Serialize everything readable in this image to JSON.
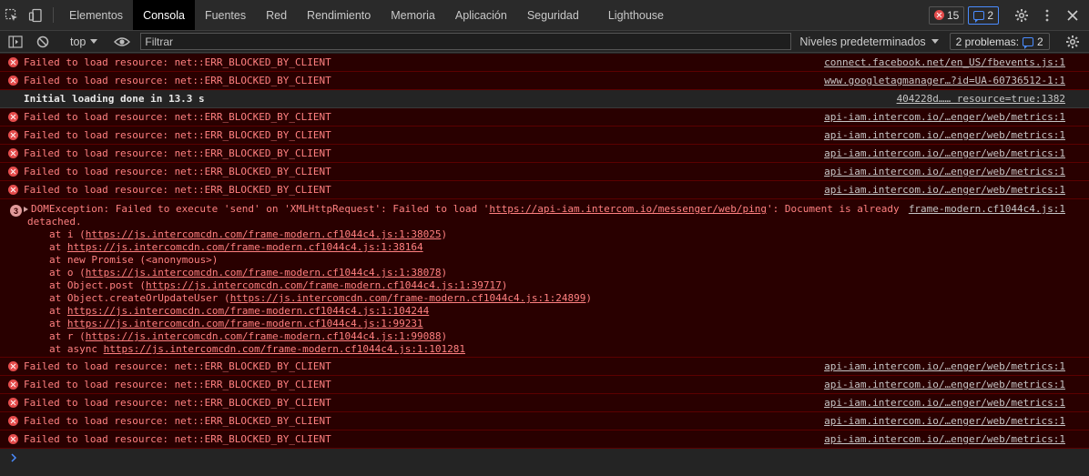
{
  "tabs": [
    "Elementos",
    "Consola",
    "Fuentes",
    "Red",
    "Rendimiento",
    "Memoria",
    "Aplicación",
    "Seguridad",
    "Lighthouse"
  ],
  "active_tab": "Consola",
  "badges": {
    "errors": "15",
    "issues": "2"
  },
  "toolbar": {
    "context": "top",
    "filter_placeholder": "Filtrar",
    "levels": "Niveles predeterminados",
    "problems_label": "2 problemas:",
    "problems_count": "2"
  },
  "messages": [
    {
      "type": "error",
      "text": "Failed to load resource: net::ERR_BLOCKED_BY_CLIENT",
      "source": "connect.facebook.net/en_US/fbevents.js:1"
    },
    {
      "type": "error",
      "text": "Failed to load resource: net::ERR_BLOCKED_BY_CLIENT",
      "source": "www.googletagmanager…?id=UA-60736512-1:1"
    },
    {
      "type": "info",
      "text": "Initial loading done in 13.3 s",
      "source": "404228d…… resource=true:1382"
    },
    {
      "type": "error",
      "text": "Failed to load resource: net::ERR_BLOCKED_BY_CLIENT",
      "source": "api-iam.intercom.io/…enger/web/metrics:1"
    },
    {
      "type": "error",
      "text": "Failed to load resource: net::ERR_BLOCKED_BY_CLIENT",
      "source": "api-iam.intercom.io/…enger/web/metrics:1"
    },
    {
      "type": "error",
      "text": "Failed to load resource: net::ERR_BLOCKED_BY_CLIENT",
      "source": "api-iam.intercom.io/…enger/web/metrics:1"
    },
    {
      "type": "error",
      "text": "Failed to load resource: net::ERR_BLOCKED_BY_CLIENT",
      "source": "api-iam.intercom.io/…enger/web/metrics:1"
    },
    {
      "type": "error",
      "text": "Failed to load resource: net::ERR_BLOCKED_BY_CLIENT",
      "source": "api-iam.intercom.io/…enger/web/metrics:1"
    }
  ],
  "exception": {
    "repeat": "3",
    "prefix": "DOMException: Failed to execute 'send' on 'XMLHttpRequest': Failed to load '",
    "url": "https://api-iam.intercom.io/messenger/web/ping",
    "suffix": "': Document is already",
    "line2": "detached.",
    "source": "frame-modern.cf1044c4.js:1",
    "stack": [
      {
        "pre": "at i (",
        "url": "https://js.intercomcdn.com/frame-modern.cf1044c4.js:1:38025",
        "post": ")"
      },
      {
        "pre": "at ",
        "url": "https://js.intercomcdn.com/frame-modern.cf1044c4.js:1:38164",
        "post": ""
      },
      {
        "pre": "at new Promise (<anonymous>)",
        "url": "",
        "post": ""
      },
      {
        "pre": "at o (",
        "url": "https://js.intercomcdn.com/frame-modern.cf1044c4.js:1:38078",
        "post": ")"
      },
      {
        "pre": "at Object.post (",
        "url": "https://js.intercomcdn.com/frame-modern.cf1044c4.js:1:39717",
        "post": ")"
      },
      {
        "pre": "at Object.createOrUpdateUser (",
        "url": "https://js.intercomcdn.com/frame-modern.cf1044c4.js:1:24899",
        "post": ")"
      },
      {
        "pre": "at ",
        "url": "https://js.intercomcdn.com/frame-modern.cf1044c4.js:1:104244",
        "post": ""
      },
      {
        "pre": "at ",
        "url": "https://js.intercomcdn.com/frame-modern.cf1044c4.js:1:99231",
        "post": ""
      },
      {
        "pre": "at r (",
        "url": "https://js.intercomcdn.com/frame-modern.cf1044c4.js:1:99088",
        "post": ")"
      },
      {
        "pre": "at async ",
        "url": "https://js.intercomcdn.com/frame-modern.cf1044c4.js:1:101281",
        "post": ""
      }
    ]
  },
  "messages_after": [
    {
      "type": "error",
      "text": "Failed to load resource: net::ERR_BLOCKED_BY_CLIENT",
      "source": "api-iam.intercom.io/…enger/web/metrics:1"
    },
    {
      "type": "error",
      "text": "Failed to load resource: net::ERR_BLOCKED_BY_CLIENT",
      "source": "api-iam.intercom.io/…enger/web/metrics:1"
    },
    {
      "type": "error",
      "text": "Failed to load resource: net::ERR_BLOCKED_BY_CLIENT",
      "source": "api-iam.intercom.io/…enger/web/metrics:1"
    },
    {
      "type": "error",
      "text": "Failed to load resource: net::ERR_BLOCKED_BY_CLIENT",
      "source": "api-iam.intercom.io/…enger/web/metrics:1"
    },
    {
      "type": "error",
      "text": "Failed to load resource: net::ERR_BLOCKED_BY_CLIENT",
      "source": "api-iam.intercom.io/…enger/web/metrics:1"
    }
  ],
  "icons": {
    "inspect": "inspect-element-icon",
    "device": "device-toolbar-icon",
    "sidebar": "sidebar-toggle-icon",
    "clear": "clear-console-icon",
    "eye": "live-expression-icon",
    "settings": "gear-icon",
    "more": "more-vertical-icon",
    "close": "close-icon",
    "prompt": "chevron-right-icon"
  },
  "colors": {
    "error_bg": "#290000",
    "error_text": "#ff8080",
    "accent": "#4a8cff"
  }
}
